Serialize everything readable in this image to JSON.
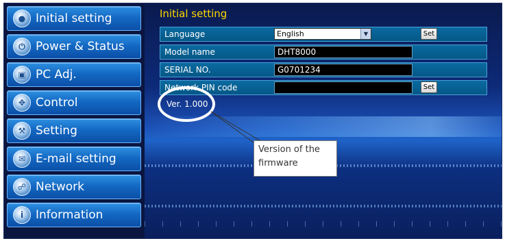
{
  "sidebar": {
    "items": [
      {
        "label": "Initial setting",
        "icon": "initial-setting-icon"
      },
      {
        "label": "Power & Status",
        "icon": "power-icon"
      },
      {
        "label": "PC Adj.",
        "icon": "monitor-icon"
      },
      {
        "label": "Control",
        "icon": "control-icon"
      },
      {
        "label": "Setting",
        "icon": "wrench-icon"
      },
      {
        "label": "E-mail setting",
        "icon": "mail-icon"
      },
      {
        "label": "Network",
        "icon": "network-icon"
      },
      {
        "label": "Information",
        "icon": "info-icon"
      }
    ]
  },
  "main": {
    "title": "Initial setting",
    "language": {
      "label": "Language",
      "value": "English",
      "set_label": "Set"
    },
    "model": {
      "label": "Model name",
      "value": "DHT8000"
    },
    "serial": {
      "label": "SERIAL NO.",
      "value": "G0701234"
    },
    "pin": {
      "label": "Network PIN code",
      "value": "",
      "set_label": "Set"
    },
    "version": "Ver. 1.000"
  },
  "callout": {
    "line1": "Version of the",
    "line2": "firmware"
  },
  "colors": {
    "title": "#ffd800",
    "nav_button": "#1469c4",
    "row_bg": "#0a6aa0"
  }
}
